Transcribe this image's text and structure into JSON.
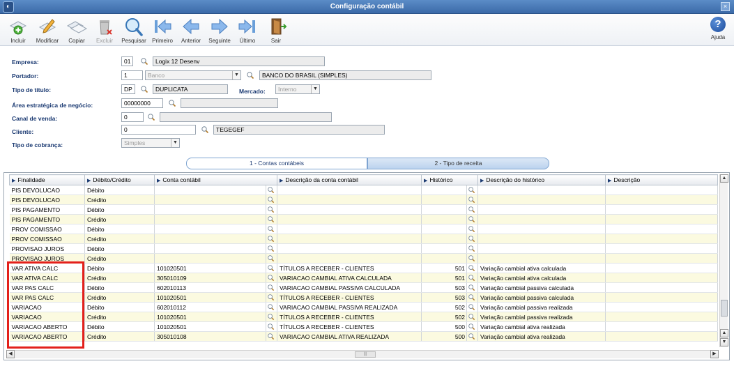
{
  "window": {
    "title": "Configuração contábil"
  },
  "toolbar": {
    "buttons": [
      {
        "label": "Incluir",
        "icon": "add-document-icon",
        "enabled": true
      },
      {
        "label": "Modificar",
        "icon": "edit-pencil-icon",
        "enabled": true
      },
      {
        "label": "Copiar",
        "icon": "copy-icon",
        "enabled": true
      },
      {
        "label": "Excluir",
        "icon": "trash-icon",
        "enabled": false
      },
      {
        "label": "Pesquisar",
        "icon": "search-icon",
        "enabled": true
      },
      {
        "label": "Primeiro",
        "icon": "first-icon",
        "enabled": true
      },
      {
        "label": "Anterior",
        "icon": "previous-icon",
        "enabled": true
      },
      {
        "label": "Seguinte",
        "icon": "next-icon",
        "enabled": true
      },
      {
        "label": "Último",
        "icon": "last-icon",
        "enabled": true
      },
      {
        "label": "Sair",
        "icon": "exit-door-icon",
        "enabled": true
      }
    ],
    "help_label": "Ajuda"
  },
  "form": {
    "empresa": {
      "label": "Empresa:",
      "code": "01",
      "desc": "Logix 12 Desenv"
    },
    "portador": {
      "label": "Portador:",
      "code": "1",
      "combo": "Banco",
      "desc": "BANCO DO BRASIL (SIMPLES)"
    },
    "tipo_titulo": {
      "label": "Tipo de título:",
      "code": "DP",
      "desc": "DUPLICATA"
    },
    "mercado": {
      "label": "Mercado:",
      "value": "Interno"
    },
    "area": {
      "label": "Área estratégica de negócio:",
      "code": "00000000",
      "desc": ""
    },
    "canal": {
      "label": "Canal de venda:",
      "code": "0",
      "desc": ""
    },
    "cliente": {
      "label": "Cliente:",
      "code": "0",
      "desc": "TEGEGEF"
    },
    "tipo_cobranca": {
      "label": "Tipo de cobrança:",
      "value": "Simples"
    }
  },
  "tabs": [
    {
      "label": "1 - Contas contábeis",
      "active": true
    },
    {
      "label": "2 - Tipo de receita",
      "active": false
    }
  ],
  "grid": {
    "columns": [
      "Finalidade",
      "Débito/Crédito",
      "Conta contábil",
      "Descrição da conta contábil",
      "Histórico",
      "Descrição do histórico",
      "Descrição"
    ],
    "rows": [
      {
        "finalidade": "PIS DEVOLUCAO",
        "dc": "Débito",
        "conta": "",
        "desc_conta": "",
        "hist": "",
        "desc_hist": ""
      },
      {
        "finalidade": "PIS DEVOLUCAO",
        "dc": "Crédito",
        "conta": "",
        "desc_conta": "",
        "hist": "",
        "desc_hist": ""
      },
      {
        "finalidade": "PIS PAGAMENTO",
        "dc": "Débito",
        "conta": "",
        "desc_conta": "",
        "hist": "",
        "desc_hist": ""
      },
      {
        "finalidade": "PIS PAGAMENTO",
        "dc": "Crédito",
        "conta": "",
        "desc_conta": "",
        "hist": "",
        "desc_hist": ""
      },
      {
        "finalidade": "PROV COMISSAO",
        "dc": "Débito",
        "conta": "",
        "desc_conta": "",
        "hist": "",
        "desc_hist": ""
      },
      {
        "finalidade": "PROV COMISSAO",
        "dc": "Crédito",
        "conta": "",
        "desc_conta": "",
        "hist": "",
        "desc_hist": ""
      },
      {
        "finalidade": "PROVISAO JUROS",
        "dc": "Débito",
        "conta": "",
        "desc_conta": "",
        "hist": "",
        "desc_hist": ""
      },
      {
        "finalidade": "PROVISAO JUROS",
        "dc": "Crédito",
        "conta": "",
        "desc_conta": "",
        "hist": "",
        "desc_hist": ""
      },
      {
        "finalidade": "VAR ATIVA CALC",
        "dc": "Débito",
        "conta": "101020501",
        "desc_conta": "TÍTULOS A RECEBER - CLIENTES",
        "hist": "501",
        "desc_hist": "Variação cambial ativa calculada"
      },
      {
        "finalidade": "VAR ATIVA CALC",
        "dc": "Crédito",
        "conta": "305010109",
        "desc_conta": "VARIACAO CAMBIAL ATIVA CALCULADA",
        "hist": "501",
        "desc_hist": "Variação cambial ativa calculada"
      },
      {
        "finalidade": "VAR PAS CALC",
        "dc": "Débito",
        "conta": "602010113",
        "desc_conta": "VARIACAO CAMBIAL PASSIVA CALCULADA",
        "hist": "503",
        "desc_hist": "Variação cambial passiva calculada"
      },
      {
        "finalidade": "VAR PAS CALC",
        "dc": "Crédito",
        "conta": "101020501",
        "desc_conta": "TÍTULOS A RECEBER - CLIENTES",
        "hist": "503",
        "desc_hist": "Variação cambial passiva calculada"
      },
      {
        "finalidade": "VARIACAO",
        "dc": "Débito",
        "conta": "602010112",
        "desc_conta": "VARIACAO CAMBIAL PASSIVA REALIZADA",
        "hist": "502",
        "desc_hist": "Variação cambial passiva realizada"
      },
      {
        "finalidade": "VARIACAO",
        "dc": "Crédito",
        "conta": "101020501",
        "desc_conta": "TÍTULOS A RECEBER - CLIENTES",
        "hist": "502",
        "desc_hist": "Variação cambial passiva realizada"
      },
      {
        "finalidade": "VARIACAO ABERTO",
        "dc": "Débito",
        "conta": "101020501",
        "desc_conta": "TÍTULOS A RECEBER - CLIENTES",
        "hist": "500",
        "desc_hist": "Variação cambial ativa realizada"
      },
      {
        "finalidade": "VARIACAO ABERTO",
        "dc": "Crédito",
        "conta": "305010108",
        "desc_conta": "VARIACAO CAMBIAL ATIVA REALIZADA",
        "hist": "500",
        "desc_hist": "Variação cambial ativa realizada"
      }
    ]
  },
  "colors": {
    "highlight": "#e3201b",
    "title_bar": "#3b6aa8",
    "label": "#1b3a72",
    "alt_row": "#fbfae0"
  }
}
